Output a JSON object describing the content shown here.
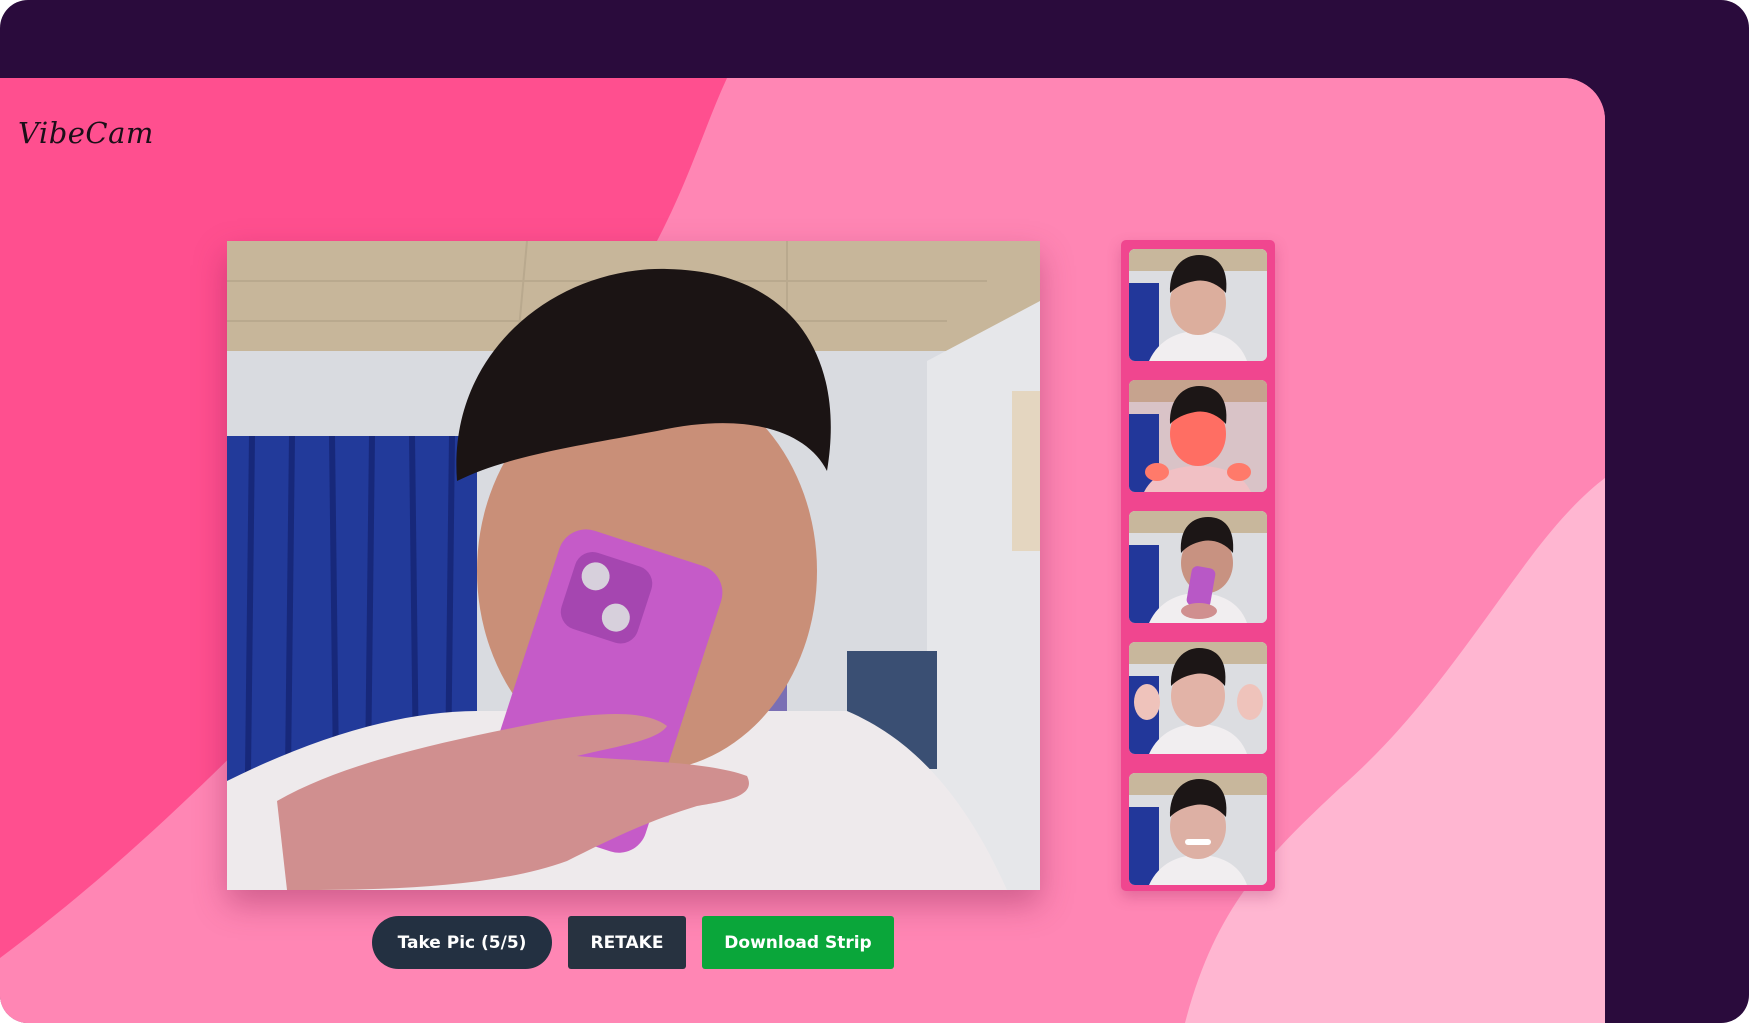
{
  "app": {
    "logo_text": "VibeCam"
  },
  "camera": {
    "description_icon": "live-camera-feed"
  },
  "strip": {
    "photo_count": 5,
    "photos": [
      {
        "tint": "#e8e4e6"
      },
      {
        "tint": "#ff7a6a"
      },
      {
        "tint": "#f3e3ea"
      },
      {
        "tint": "#f0d6de"
      },
      {
        "tint": "#ece6e8"
      }
    ]
  },
  "controls": {
    "take_pic_label": "Take Pic (5/5)",
    "retake_label": "RETAKE",
    "download_label": "Download Strip"
  },
  "colors": {
    "outer_bg": "#2a0b3c",
    "hot_pink": "#ff4f8f",
    "mid_pink": "#ff86b4",
    "light_pink": "#ffb6d1",
    "strip_pink": "#f0468f",
    "take_button": "#233041",
    "retake_button": "#273240",
    "download_button": "#0aa63a"
  }
}
